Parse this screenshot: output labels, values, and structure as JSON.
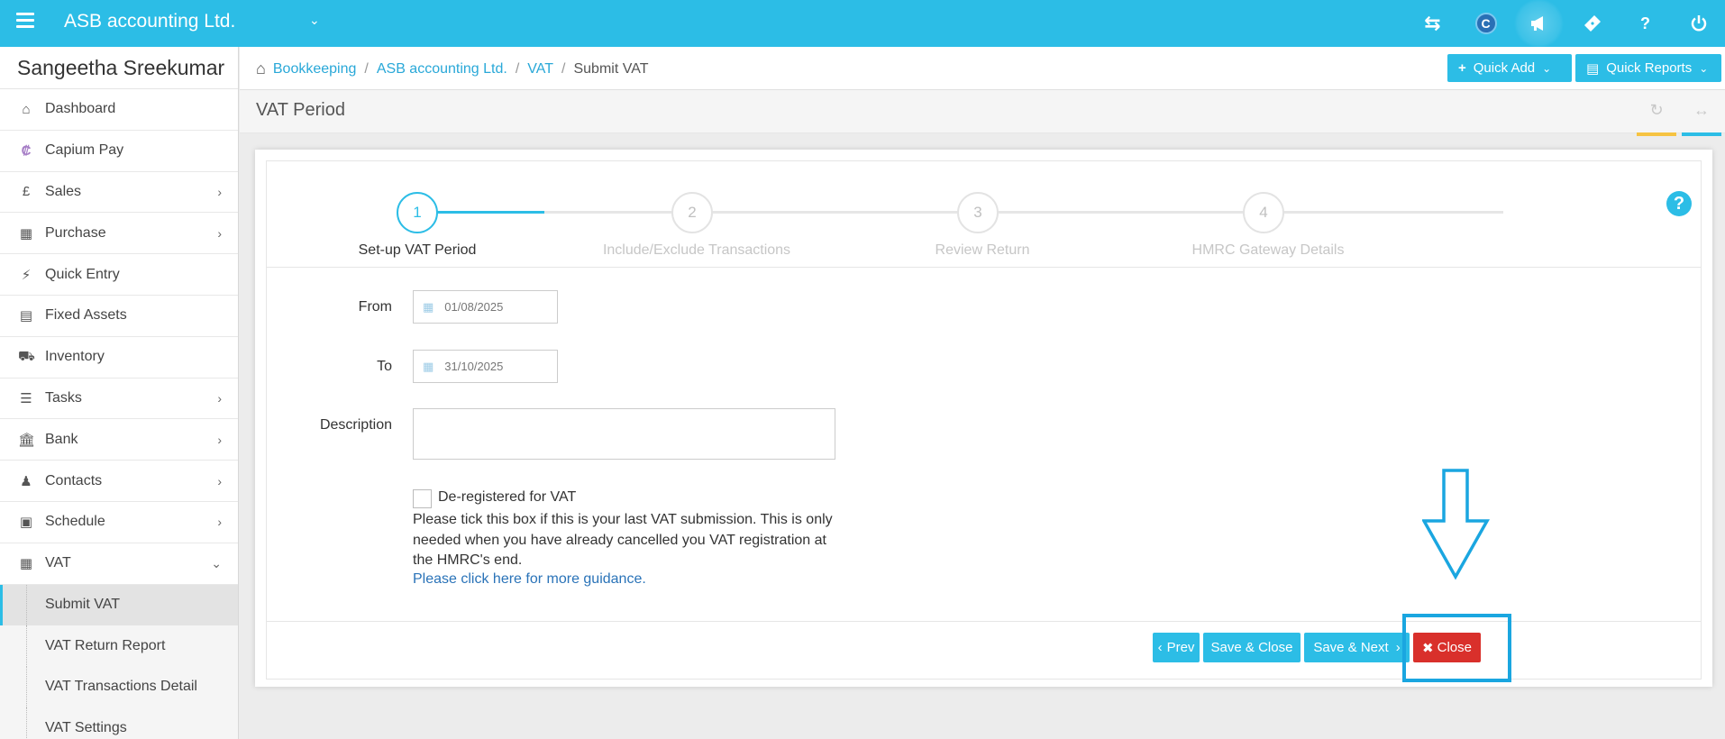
{
  "topbar": {
    "company": "ASB accounting Ltd.",
    "icons": [
      "swap-arrows-icon",
      "capium-logo-icon",
      "megaphone-icon",
      "ticket-icon",
      "help-icon",
      "power-icon"
    ],
    "capium_letter": "C",
    "help_glyph": "?"
  },
  "sidebar": {
    "user_name": "Sangeetha Sreekumar",
    "items": [
      {
        "label": "Dashboard",
        "icon": "home-icon"
      },
      {
        "label": "Capium Pay",
        "icon": "capium-pay-icon"
      },
      {
        "label": "Sales",
        "icon": "pound-icon"
      },
      {
        "label": "Purchase",
        "icon": "barcode-icon"
      },
      {
        "label": "Quick Entry",
        "icon": "bolt-icon"
      },
      {
        "label": "Fixed Assets",
        "icon": "building-icon"
      },
      {
        "label": "Inventory",
        "icon": "truck-icon"
      },
      {
        "label": "Tasks",
        "icon": "tasks-icon"
      },
      {
        "label": "Bank",
        "icon": "bank-icon"
      },
      {
        "label": "Contacts",
        "icon": "users-icon"
      },
      {
        "label": "Schedule",
        "icon": "calendar-icon"
      },
      {
        "label": "VAT",
        "icon": "calculator-icon"
      }
    ],
    "vat_sub": [
      "Submit VAT",
      "VAT Return Report",
      "VAT Transactions Detail",
      "VAT Settings"
    ]
  },
  "breadcrumb": {
    "items": [
      "Bookkeeping",
      "ASB accounting Ltd.",
      "VAT"
    ],
    "current": "Submit VAT",
    "sep": "/"
  },
  "quick": {
    "add": "Quick Add",
    "reports": "Quick Reports"
  },
  "page": {
    "title": "VAT Period"
  },
  "wizard": {
    "steps": [
      {
        "num": "1",
        "label": "Set-up VAT Period"
      },
      {
        "num": "2",
        "label": "Include/Exclude Transactions"
      },
      {
        "num": "3",
        "label": "Review Return"
      },
      {
        "num": "4",
        "label": "HMRC Gateway Details"
      }
    ],
    "active_step": 1
  },
  "form": {
    "from_label": "From",
    "from_value": "01/08/2025",
    "to_label": "To",
    "to_value": "31/10/2025",
    "description_label": "Description",
    "description_value": "",
    "dereg_label": "De-registered for VAT",
    "dereg_checked": false,
    "help_text": "Please tick this box if this is your last VAT submission. This is only needed when you have already cancelled you VAT registration at the HMRC's end.",
    "guidance_link": "Please click here for more guidance."
  },
  "footer": {
    "prev": "Prev",
    "save_close": "Save & Close",
    "save_next": "Save & Next",
    "close": "Close"
  },
  "colors": {
    "brand": "#2cbde6",
    "danger": "#d9302b",
    "link": "#2a73b8",
    "annotation": "#1aa6e0"
  }
}
